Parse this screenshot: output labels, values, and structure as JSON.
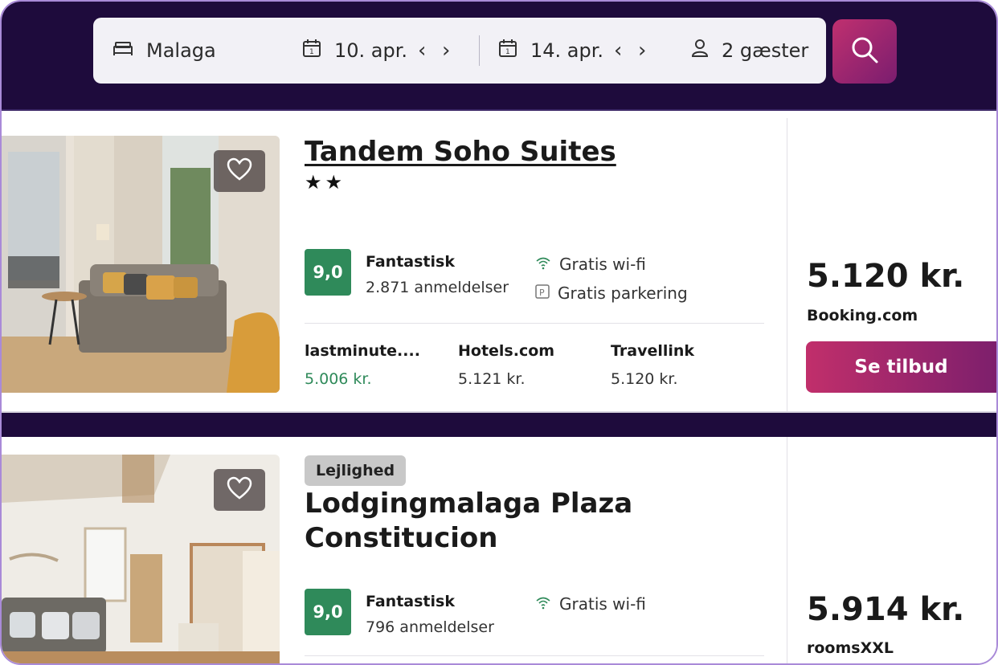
{
  "search": {
    "destination": "Malaga",
    "checkin": "10. apr.",
    "checkout": "14. apr.",
    "guests": "2 gæster"
  },
  "hotels": [
    {
      "name": "Tandem Soho Suites",
      "stars": "★★",
      "score": "9,0",
      "rating_label": "Fantastisk",
      "reviews": "2.871 anmeldelser",
      "amenities": [
        "Gratis wi-fi",
        "Gratis parkering"
      ],
      "providers": [
        {
          "name": "lastminute....",
          "price": "5.006 kr."
        },
        {
          "name": "Hotels.com",
          "price": "5.121 kr."
        },
        {
          "name": "Travellink",
          "price": "5.120 kr."
        }
      ],
      "price": "5.120 kr.",
      "source": "Booking.com",
      "cta": "Se tilbud"
    },
    {
      "tag": "Lejlighed",
      "name_line1": "Lodgingmalaga Plaza",
      "name_line2": "Constitucion",
      "score": "9,0",
      "rating_label": "Fantastisk",
      "reviews": "796 anmeldelser",
      "amenities": [
        "Gratis wi-fi"
      ],
      "price": "5.914 kr.",
      "source": "roomsXXL"
    }
  ],
  "icons": {
    "bed": "bed-icon",
    "calendar": "calendar-icon",
    "guests": "user-icon",
    "search": "search-icon",
    "favorite": "heart-icon",
    "wifi": "wifi-icon",
    "parking": "parking-icon"
  },
  "colors": {
    "header_bg": "#1e0b3c",
    "score_green": "#2f8a5a",
    "cta_gradient_start": "#c12f6b",
    "cta_gradient_end": "#7d1f6c"
  }
}
